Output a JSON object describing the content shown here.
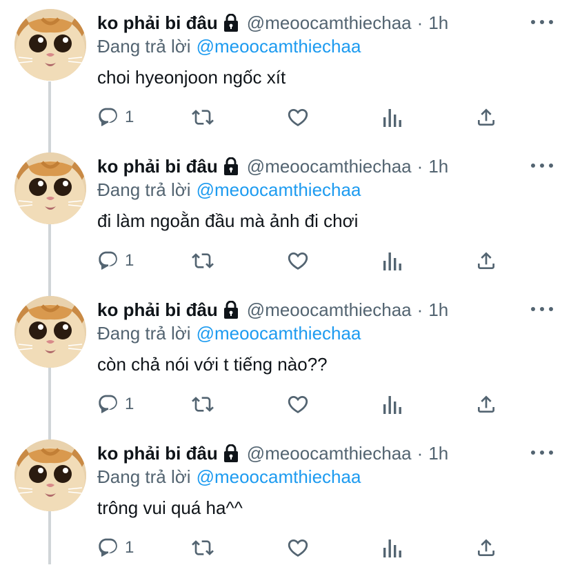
{
  "tweets": [
    {
      "display_name": "ko phải bi đâu",
      "handle": "@meoocamthiechaa",
      "separator": "·",
      "time": "1h",
      "replying_label": "Đang trả lời",
      "replying_to": "@meoocamthiechaa",
      "text": "choi hyeonjoon ngốc xít",
      "reply_count": "1"
    },
    {
      "display_name": "ko phải bi đâu",
      "handle": "@meoocamthiechaa",
      "separator": "·",
      "time": "1h",
      "replying_label": "Đang trả lời",
      "replying_to": "@meoocamthiechaa",
      "text": "đi làm ngoằn đầu mà ảnh đi chơi",
      "reply_count": "1"
    },
    {
      "display_name": "ko phải bi đâu",
      "handle": "@meoocamthiechaa",
      "separator": "·",
      "time": "1h",
      "replying_label": "Đang trả lời",
      "replying_to": "@meoocamthiechaa",
      "text": "còn chả nói với t tiếng nào??",
      "reply_count": "1"
    },
    {
      "display_name": "ko phải bi đâu",
      "handle": "@meoocamthiechaa",
      "separator": "·",
      "time": "1h",
      "replying_label": "Đang trả lời",
      "replying_to": "@meoocamthiechaa",
      "text": "trông vui quá ha^^",
      "reply_count": "1"
    }
  ],
  "icons": {
    "lock": "lock-icon",
    "more": "more-options-icon",
    "reply": "reply-icon",
    "retweet": "retweet-icon",
    "like": "heart-icon",
    "analytics": "analytics-icon",
    "share": "share-icon"
  },
  "colors": {
    "text_primary": "#0f1419",
    "text_secondary": "#536471",
    "mention": "#1d9bf0",
    "thread_line": "#d0d5d8"
  }
}
